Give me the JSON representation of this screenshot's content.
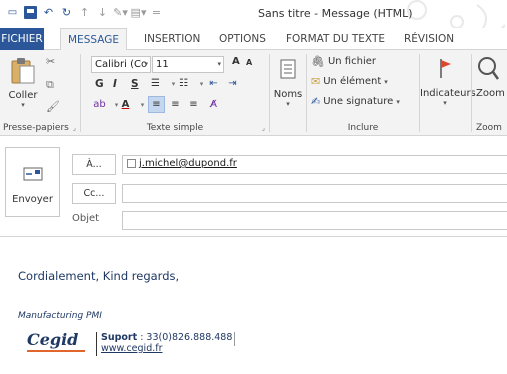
{
  "window": {
    "title": "Sans titre - Message (HTML)"
  },
  "tabs": [
    {
      "label": "FICHIER"
    },
    {
      "label": "MESSAGE"
    },
    {
      "label": "INSERTION"
    },
    {
      "label": "OPTIONS"
    },
    {
      "label": "FORMAT DU TEXTE"
    },
    {
      "label": "RÉVISION"
    }
  ],
  "ribbon": {
    "clipboard": {
      "paste_label": "Coller",
      "group_label": "Presse-papiers"
    },
    "basic_text": {
      "font_name": "Calibri (Co",
      "font_size": "11",
      "grow_glyph": "A",
      "shrink_glyph": "A",
      "bold": "G",
      "italic": "I",
      "underline": "S",
      "group_label": "Texte simple"
    },
    "names": {
      "label": "Noms"
    },
    "include": {
      "attach_file": "Un fichier",
      "attach_item": "Un élément",
      "signature": "Une signature",
      "group_label": "Inclure"
    },
    "tags": {
      "label": "Indicateurs"
    },
    "zoom": {
      "label": "Zoom",
      "group_label": "Zoom"
    }
  },
  "header": {
    "send_label": "Envoyer",
    "to_button": "À...",
    "cc_button": "Cc...",
    "subject_label": "Objet",
    "to_value": "j.michel@dupond.fr",
    "cc_value": "",
    "subject_value": ""
  },
  "body": {
    "greeting": "Cordialement, Kind regards,",
    "company": "Manufacturing PMI",
    "logo_text": "Cegid",
    "support_label": "Suport",
    "support_phone": " : 33(0)826.888.488",
    "website": "www.cegid.fr"
  },
  "colors": {
    "accent": "#2b579a",
    "text_blue": "#1f3864",
    "logo_orange": "#e0662c"
  }
}
